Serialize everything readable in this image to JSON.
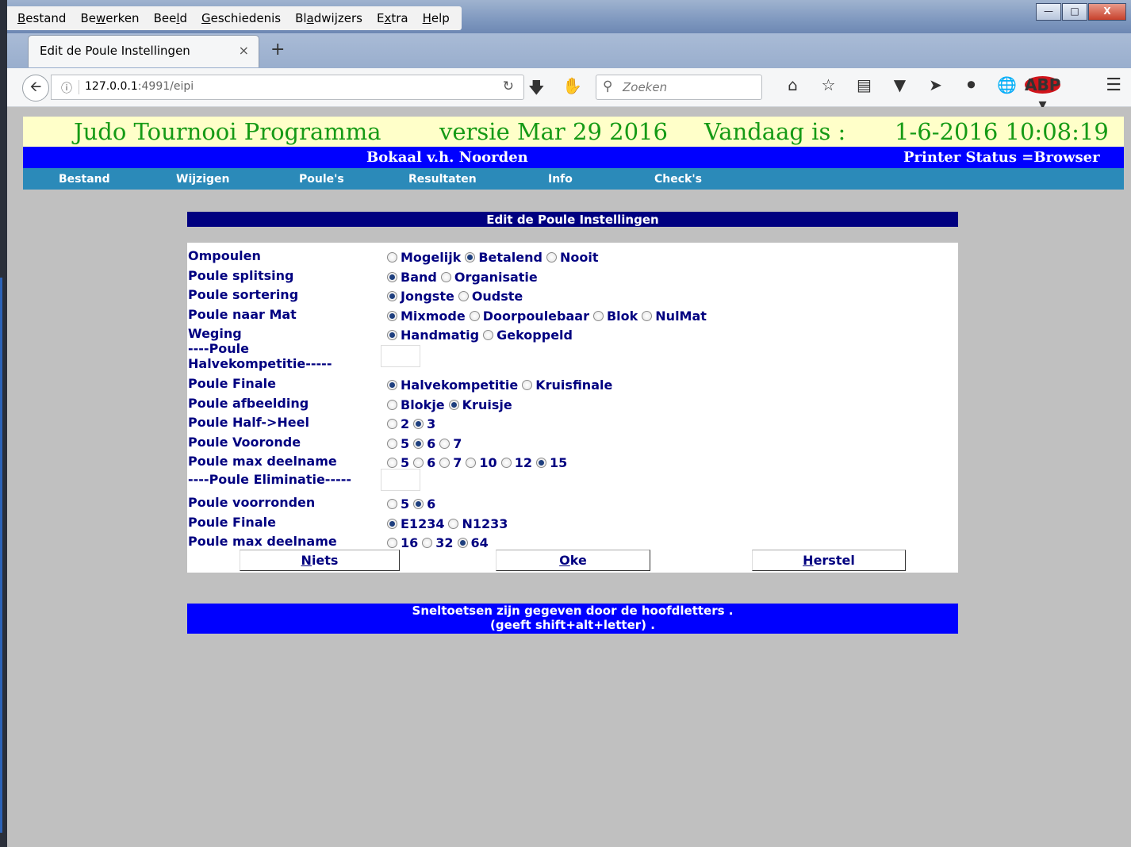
{
  "browser": {
    "menu": [
      {
        "pre": "",
        "u": "B",
        "post": "estand"
      },
      {
        "pre": "Be",
        "u": "w",
        "post": "erken"
      },
      {
        "pre": "Bee",
        "u": "l",
        "post": "d"
      },
      {
        "pre": "",
        "u": "G",
        "post": "eschiedenis"
      },
      {
        "pre": "Bl",
        "u": "a",
        "post": "dwijzers"
      },
      {
        "pre": "E",
        "u": "x",
        "post": "tra"
      },
      {
        "pre": "",
        "u": "H",
        "post": "elp"
      }
    ],
    "tab_title": "Edit de Poule Instellingen",
    "url_host": "127.0.0.1",
    "url_rest": ":4991/eipi",
    "search_placeholder": "Zoeken"
  },
  "banner": {
    "app": "Judo Tournooi Programma",
    "version": "versie Mar 29 2016",
    "today_label": "Vandaag is :",
    "datetime": "1-6-2016 10:08:19"
  },
  "subheader": {
    "tournament": "Bokaal v.h. Noorden",
    "printer": "Printer Status =Browser"
  },
  "nav": [
    "Bestand",
    "Wijzigen",
    "Poule's",
    "Resultaten",
    "Info",
    "Check's"
  ],
  "form": {
    "heading": "Edit de Poule Instellingen",
    "rows": [
      {
        "label": "Ompoulen",
        "options": [
          {
            "t": "Mogelijk",
            "on": false
          },
          {
            "t": "Betalend",
            "on": true
          },
          {
            "t": "Nooit",
            "on": false
          }
        ]
      },
      {
        "label": "Poule splitsing",
        "options": [
          {
            "t": "Band",
            "on": true
          },
          {
            "t": "Organisatie",
            "on": false
          }
        ]
      },
      {
        "label": "Poule sortering",
        "options": [
          {
            "t": "Jongste",
            "on": true
          },
          {
            "t": "Oudste",
            "on": false
          }
        ]
      },
      {
        "label": "Poule naar Mat",
        "options": [
          {
            "t": "Mixmode",
            "on": true
          },
          {
            "t": "Doorpoulebaar",
            "on": false
          },
          {
            "t": "Blok",
            "on": false
          },
          {
            "t": "NulMat",
            "on": false
          }
        ]
      },
      {
        "label": "Weging",
        "options": [
          {
            "t": "Handmatig",
            "on": true
          },
          {
            "t": "Gekoppeld",
            "on": false
          }
        ]
      },
      {
        "label": "Poule Finale",
        "options": [
          {
            "t": "Halvekompetitie",
            "on": true
          },
          {
            "t": "Kruisfinale",
            "on": false
          }
        ]
      },
      {
        "label": "Poule afbeelding",
        "options": [
          {
            "t": "Blokje",
            "on": false
          },
          {
            "t": "Kruisje",
            "on": true
          }
        ]
      },
      {
        "label": "Poule Half->Heel",
        "options": [
          {
            "t": "2",
            "on": false
          },
          {
            "t": "3",
            "on": true
          }
        ]
      },
      {
        "label": "Poule Vooronde",
        "options": [
          {
            "t": "5",
            "on": false
          },
          {
            "t": "6",
            "on": true
          },
          {
            "t": "7",
            "on": false
          }
        ]
      },
      {
        "label": "Poule max deelname",
        "options": [
          {
            "t": "5",
            "on": false
          },
          {
            "t": "6",
            "on": false
          },
          {
            "t": "7",
            "on": false
          },
          {
            "t": "10",
            "on": false
          },
          {
            "t": "12",
            "on": false
          },
          {
            "t": "15",
            "on": true
          }
        ]
      },
      {
        "label": "Poule voorronden",
        "options": [
          {
            "t": "5",
            "on": false
          },
          {
            "t": "6",
            "on": true
          }
        ]
      },
      {
        "label": "Poule Finale",
        "options": [
          {
            "t": "E1234",
            "on": true
          },
          {
            "t": "N1233",
            "on": false
          }
        ]
      },
      {
        "label": "Poule max deelname",
        "options": [
          {
            "t": "16",
            "on": false
          },
          {
            "t": "32",
            "on": false
          },
          {
            "t": "64",
            "on": true
          }
        ]
      }
    ],
    "section_halve_line1": "----Poule",
    "section_halve_line2": "Halvekompetitie-----",
    "section_elim": "----Poule Eliminatie-----",
    "buttons": [
      {
        "u": "N",
        "rest": "iets"
      },
      {
        "u": "O",
        "rest": "ke"
      },
      {
        "u": "H",
        "rest": "erstel"
      }
    ]
  },
  "footer": {
    "line1": "Sneltoetsen zijn gegeven door de hoofdletters .",
    "line2": "(geeft shift+alt+letter) ."
  }
}
